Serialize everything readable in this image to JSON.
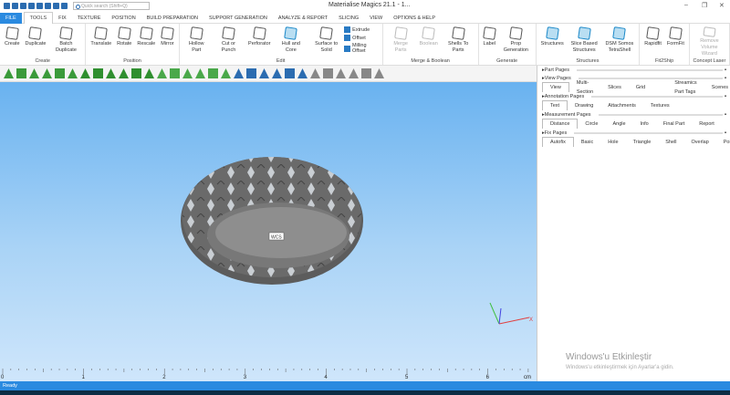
{
  "window": {
    "title": "Materialise Magics 21.1 - 1...",
    "search_placeholder": "Quick search (Shift+Q)",
    "minimize": "–",
    "restore": "❐",
    "close": "✕"
  },
  "tabs": [
    "FILE",
    "TOOLS",
    "FIX",
    "TEXTURE",
    "POSITION",
    "BUILD PREPARATION",
    "SUPPORT GENERATION",
    "ANALYZE & REPORT",
    "SLICING",
    "VIEW",
    "OPTIONS & HELP"
  ],
  "active_tab": "TOOLS",
  "ribbon": {
    "create": {
      "label": "Create",
      "buttons": [
        "Create",
        "Duplicate",
        "Batch Duplicate"
      ]
    },
    "position": {
      "label": "Position",
      "buttons": [
        "Translate",
        "Rotate",
        "Rescale",
        "Mirror"
      ]
    },
    "edit": {
      "label": "Edit",
      "buttons": [
        "Hollow Part",
        "Cut or Punch",
        "Perforator",
        "Hull and Core",
        "Surface to Solid"
      ],
      "small": [
        "Extrude",
        "Offset",
        "Milling Offset"
      ]
    },
    "merge": {
      "label": "Merge & Boolean",
      "buttons": [
        "Merge Parts",
        "Boolean",
        "Shells To Parts"
      ]
    },
    "generate": {
      "label": "Generate",
      "buttons": [
        "Label",
        "Prop Generation"
      ]
    },
    "structures": {
      "label": "Structures",
      "buttons": [
        "Structures",
        "Slice Based Structures",
        "DSM Somos TetraShell"
      ]
    },
    "fit2ship": {
      "label": "Fit2Ship",
      "buttons": [
        "Rapidfit",
        "FormFit"
      ]
    },
    "concept": {
      "label": "Concept Laser",
      "buttons": [
        "Remove Volume Wizard"
      ]
    }
  },
  "viewport": {
    "wcs_label": "WCS",
    "ruler": {
      "unit": "cm",
      "ticks": [
        "0",
        "1",
        "2",
        "3",
        "4",
        "5",
        "6"
      ]
    },
    "axes": {
      "x": "X",
      "y": "Y",
      "z": "Z"
    }
  },
  "panel": {
    "part_pages": "Part Pages",
    "view_pages": {
      "title": "View Pages",
      "tabs": [
        "View",
        "Multi-Section",
        "Slices",
        "Grid"
      ],
      "extra_tabs": [
        "Streamics Part Tags",
        "Scenes"
      ]
    },
    "annotation_pages": {
      "title": "Annotation Pages",
      "tabs": [
        "Text",
        "Drawing",
        "Attachments",
        "Textures"
      ]
    },
    "measurement_pages": {
      "title": "Measurement Pages",
      "tabs": [
        "Distance",
        "Circle",
        "Angle",
        "Info",
        "Final Part",
        "Report"
      ]
    },
    "fix_pages": {
      "title": "Fix Pages",
      "tabs": [
        "Autofix",
        "Basic",
        "Hole",
        "Triangle",
        "Shell",
        "Overlap",
        "Point"
      ]
    }
  },
  "watermark": {
    "title": "Windows'u Etkinleştir",
    "subtitle": "Windows'u etkinleştirmek için Ayarlar'a gidin."
  },
  "status": "Ready",
  "colors": {
    "accent": "#2a8ae0",
    "viewport_top": "#69b2f0",
    "viewport_bottom": "#cfe6fb"
  }
}
